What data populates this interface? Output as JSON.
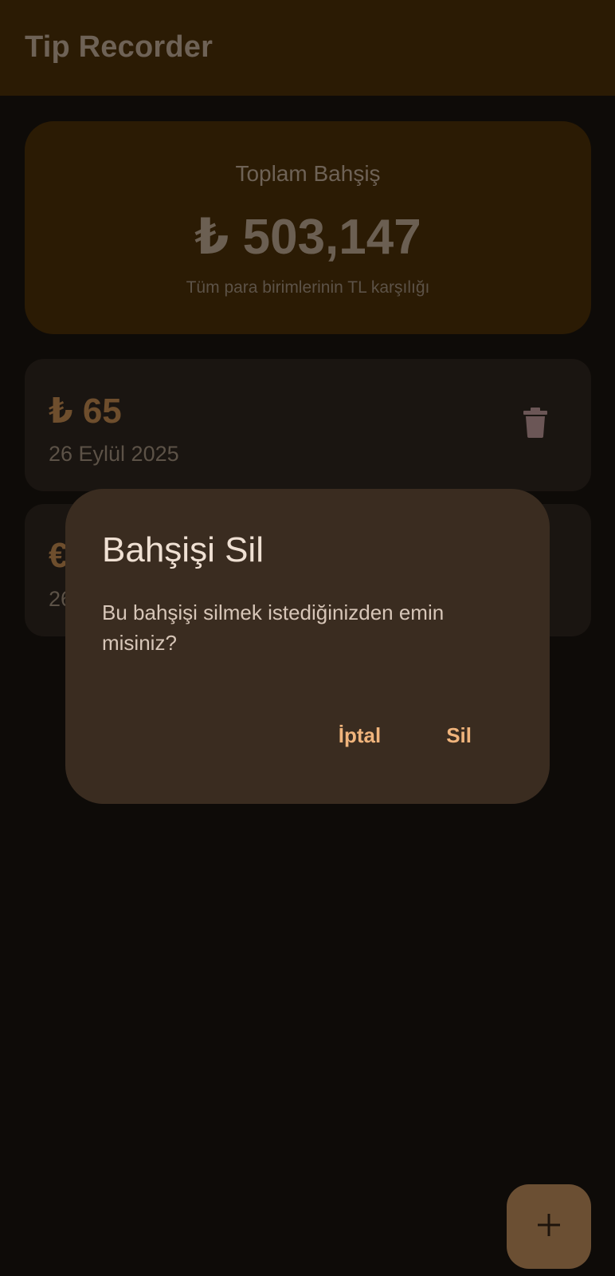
{
  "app_bar": {
    "title": "Tip Recorder"
  },
  "summary": {
    "label": "Toplam Bahşiş",
    "amount": "₺ 503,147",
    "caption": "Tüm para birimlerinin TL karşılığı"
  },
  "tips": [
    {
      "amount": "₺ 65",
      "date": "26 Eylül 2025",
      "delete_icon": "trash-icon"
    },
    {
      "amount": "€",
      "date": "26",
      "delete_icon": "trash-icon"
    }
  ],
  "dialog": {
    "title": "Bahşişi Sil",
    "message": "Bu bahşişi silmek istediğinizden emin misiniz?",
    "cancel_label": "İptal",
    "confirm_label": "Sil"
  },
  "fab": {
    "icon": "plus-icon"
  },
  "colors": {
    "background": "#0e0b08",
    "app_bar": "#2b1b04",
    "card": "#1a1511",
    "dialog": "#3a2c20",
    "accent": "#f0b47c",
    "fab": "#6b4f33"
  }
}
